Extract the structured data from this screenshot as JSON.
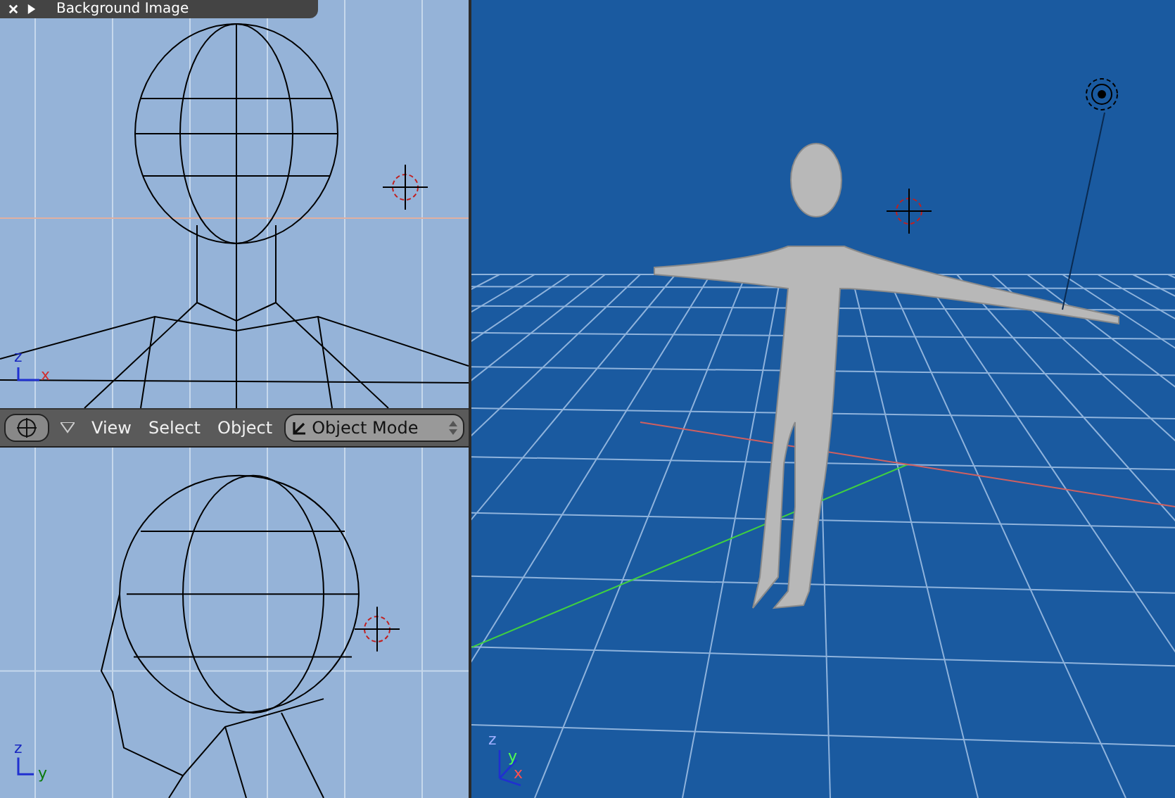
{
  "panel": {
    "title": "Background Image"
  },
  "front_view": {
    "axes": [
      "z",
      "x"
    ]
  },
  "toolbar": {
    "menus": [
      "View",
      "Select",
      "Object"
    ],
    "mode": "Object Mode"
  },
  "side_view": {
    "axes": [
      "z",
      "y"
    ]
  },
  "perspective_view": {
    "axes": [
      "z",
      "y",
      "x"
    ]
  }
}
